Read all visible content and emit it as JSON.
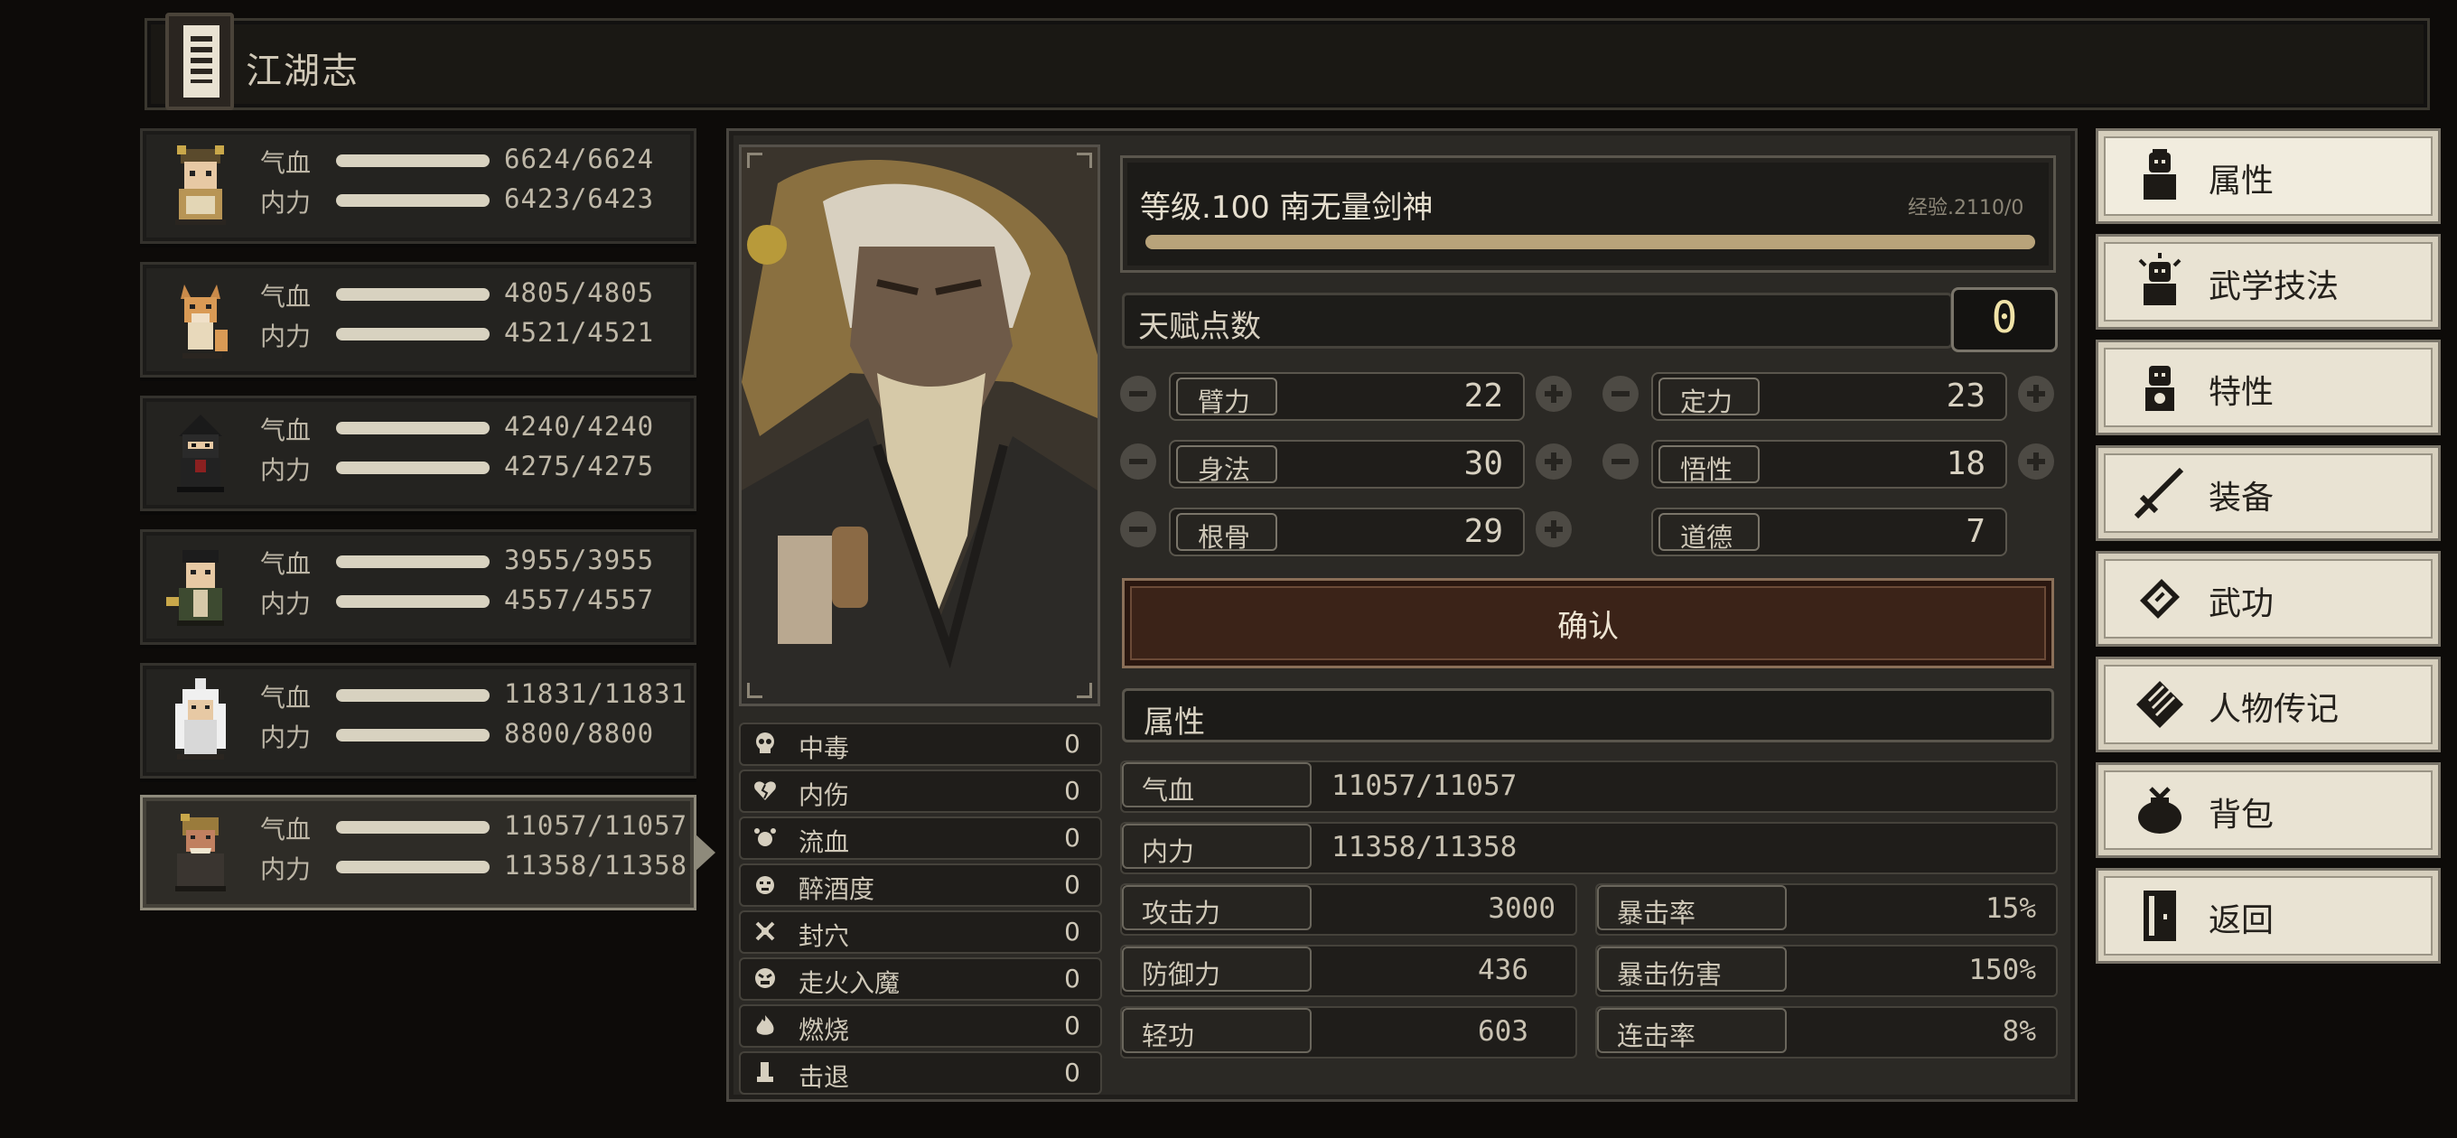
{
  "header": {
    "title": "江湖志"
  },
  "party": [
    {
      "hp_label": "气血",
      "mp_label": "内力",
      "hp": "6624/6624",
      "mp": "6423/6423"
    },
    {
      "hp_label": "气血",
      "mp_label": "内力",
      "hp": "4805/4805",
      "mp": "4521/4521"
    },
    {
      "hp_label": "气血",
      "mp_label": "内力",
      "hp": "4240/4240",
      "mp": "4275/4275"
    },
    {
      "hp_label": "气血",
      "mp_label": "内力",
      "hp": "3955/3955",
      "mp": "4557/4557"
    },
    {
      "hp_label": "气血",
      "mp_label": "内力",
      "hp": "11831/11831",
      "mp": "8800/8800"
    },
    {
      "hp_label": "气血",
      "mp_label": "内力",
      "hp": "11057/11057",
      "mp": "11358/11358"
    }
  ],
  "status_effects": [
    {
      "label": "中毒",
      "value": "0",
      "icon": "skull-icon"
    },
    {
      "label": "内伤",
      "value": "0",
      "icon": "broken-heart-icon"
    },
    {
      "label": "流血",
      "value": "0",
      "icon": "blood-drop-icon"
    },
    {
      "label": "醉酒度",
      "value": "0",
      "icon": "drunk-face-icon"
    },
    {
      "label": "封穴",
      "value": "0",
      "icon": "sealed-point-icon"
    },
    {
      "label": "走火入魔",
      "value": "0",
      "icon": "demon-face-icon"
    },
    {
      "label": "燃烧",
      "value": "0",
      "icon": "flame-icon"
    },
    {
      "label": "击退",
      "value": "0",
      "icon": "boot-icon"
    }
  ],
  "character": {
    "level_title": "等级.100 南无量剑神",
    "exp_text": "经验.2110/0",
    "exp_fill": 1.0,
    "talent_label": "天赋点数",
    "talent_points": "0"
  },
  "stats": {
    "arm_strength": {
      "label": "臂力",
      "value": "22"
    },
    "composure": {
      "label": "定力",
      "value": "23"
    },
    "agility": {
      "label": "身法",
      "value": "30"
    },
    "comprehension": {
      "label": "悟性",
      "value": "18"
    },
    "constitution": {
      "label": "根骨",
      "value": "29"
    },
    "morality": {
      "label": "道德",
      "value": "7"
    }
  },
  "confirm_label": "确认",
  "attributes": {
    "title": "属性",
    "hp": {
      "label": "气血",
      "value": "11057/11057"
    },
    "mp": {
      "label": "内力",
      "value": "11358/11358"
    },
    "attack": {
      "label": "攻击力",
      "value": "3000"
    },
    "crit_rate": {
      "label": "暴击率",
      "value": "15%"
    },
    "defense": {
      "label": "防御力",
      "value": "436"
    },
    "crit_damage": {
      "label": "暴击伤害",
      "value": "150%"
    },
    "lightness": {
      "label": "轻功",
      "value": "603"
    },
    "combo_rate": {
      "label": "连击率",
      "value": "8%"
    }
  },
  "menu": [
    {
      "label": "属性",
      "icon": "character-icon"
    },
    {
      "label": "武学技法",
      "icon": "martial-skill-icon"
    },
    {
      "label": "特性",
      "icon": "trait-icon"
    },
    {
      "label": "装备",
      "icon": "sword-icon"
    },
    {
      "label": "武功",
      "icon": "scroll-book-icon"
    },
    {
      "label": "人物传记",
      "icon": "biography-icon"
    },
    {
      "label": "背包",
      "icon": "bag-icon"
    },
    {
      "label": "返回",
      "icon": "door-icon"
    }
  ],
  "colors": {
    "accent_gold": "#b8a37a",
    "confirm_bg": "#3b2318",
    "menu_bg": "#e9e3d3"
  }
}
